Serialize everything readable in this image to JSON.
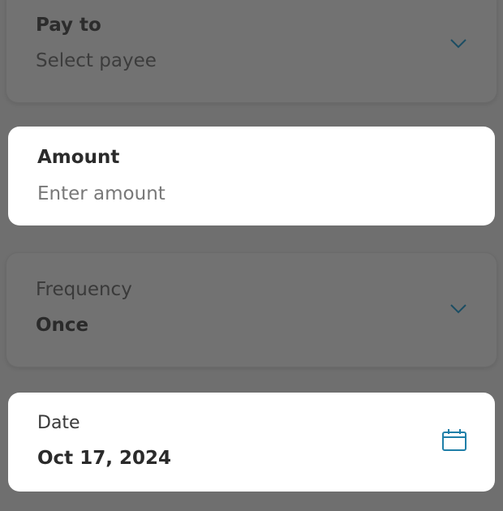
{
  "colors": {
    "accent": "#1f7fa8",
    "overlay": "#6f6f6f",
    "card": "#ffffff"
  },
  "form": {
    "pay_to": {
      "label": "Pay to",
      "placeholder": "Select payee",
      "icon": "chevron-down-icon"
    },
    "amount": {
      "label": "Amount",
      "placeholder": "Enter amount"
    },
    "frequency": {
      "label": "Frequency",
      "value": "Once",
      "icon": "chevron-down-icon"
    },
    "date": {
      "label": "Date",
      "value": "Oct 17, 2024",
      "icon": "calendar-icon"
    }
  }
}
